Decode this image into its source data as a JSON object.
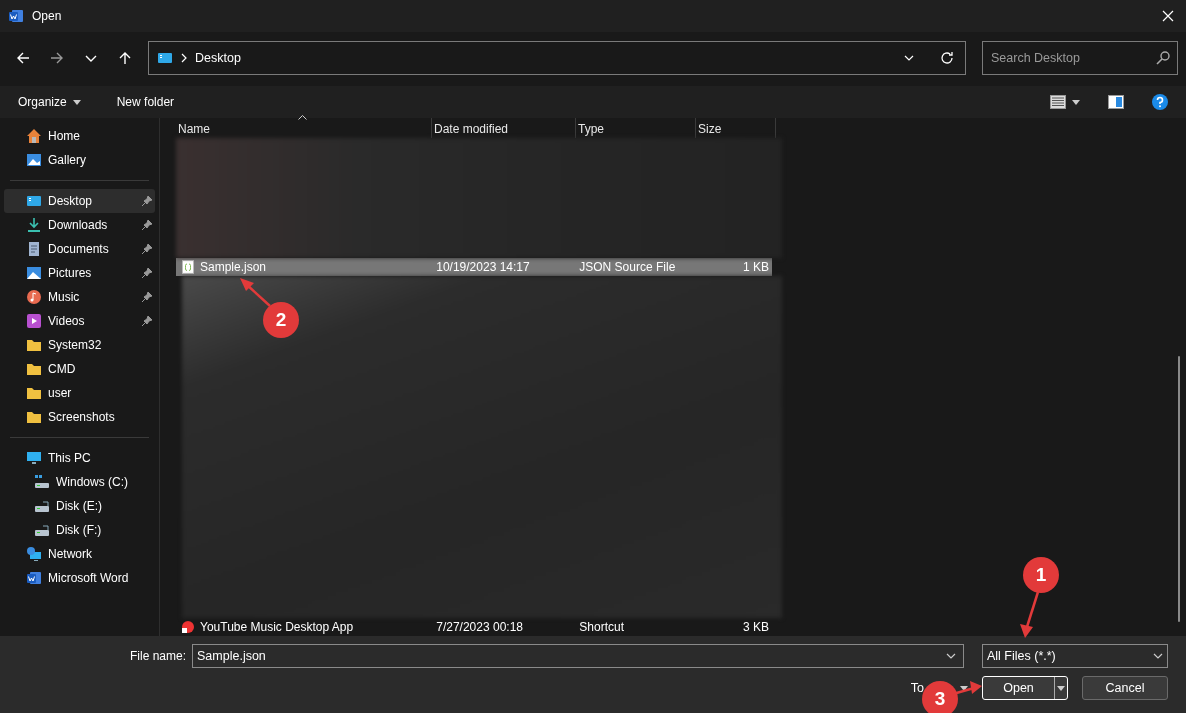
{
  "window": {
    "title": "Open"
  },
  "navigation": {
    "path": [
      "Desktop"
    ],
    "search": {
      "placeholder": "Search Desktop"
    }
  },
  "toolbar": {
    "organize": "Organize",
    "new_folder": "New folder"
  },
  "sidebar": {
    "sections": [
      [
        {
          "label": "Home",
          "kind": "home",
          "pinned": false,
          "selected": false
        },
        {
          "label": "Gallery",
          "kind": "gallery",
          "pinned": false,
          "selected": false
        }
      ],
      [
        {
          "label": "Desktop",
          "kind": "desktop",
          "pinned": true,
          "selected": true
        },
        {
          "label": "Downloads",
          "kind": "downloads",
          "pinned": true,
          "selected": false
        },
        {
          "label": "Documents",
          "kind": "documents",
          "pinned": true,
          "selected": false
        },
        {
          "label": "Pictures",
          "kind": "pictures",
          "pinned": true,
          "selected": false
        },
        {
          "label": "Music",
          "kind": "music",
          "pinned": true,
          "selected": false
        },
        {
          "label": "Videos",
          "kind": "videos",
          "pinned": true,
          "selected": false
        },
        {
          "label": "System32",
          "kind": "folder",
          "pinned": false,
          "selected": false
        },
        {
          "label": "CMD",
          "kind": "folder",
          "pinned": false,
          "selected": false
        },
        {
          "label": "user",
          "kind": "folder",
          "pinned": false,
          "selected": false
        },
        {
          "label": "Screenshots",
          "kind": "folder",
          "pinned": false,
          "selected": false
        }
      ],
      [
        {
          "label": "This PC",
          "kind": "pc",
          "pinned": false,
          "selected": false,
          "children": [
            {
              "label": "Windows (C:)",
              "kind": "system-drive",
              "pinned": false,
              "selected": false
            },
            {
              "label": "Disk (E:)",
              "kind": "drive",
              "pinned": false,
              "selected": false
            },
            {
              "label": "Disk (F:)",
              "kind": "drive",
              "pinned": false,
              "selected": false
            }
          ]
        },
        {
          "label": "Network",
          "kind": "network",
          "pinned": false,
          "selected": false
        },
        {
          "label": "Microsoft Word",
          "kind": "word",
          "pinned": false,
          "selected": false
        }
      ]
    ]
  },
  "file_list": {
    "columns": [
      {
        "label": "Name",
        "sorted": true
      },
      {
        "label": "Date modified",
        "sorted": false
      },
      {
        "label": "Type",
        "sorted": false
      },
      {
        "label": "Size",
        "sorted": false
      }
    ],
    "rows": [
      {
        "kind": "blurred"
      },
      {
        "kind": "file",
        "name": "Sample.json",
        "date": "10/19/2023 14:17",
        "type": "JSON Source File",
        "size": "1 KB",
        "selected": true
      },
      {
        "kind": "blurred"
      },
      {
        "kind": "file",
        "name": "YouTube Music Desktop App",
        "date": "7/27/2023 00:18",
        "type": "Shortcut",
        "size": "3 KB",
        "selected": false
      }
    ]
  },
  "footer": {
    "file_name_label": "File name:",
    "file_name": "Sample.json",
    "file_type": "All Files (*.*)",
    "tools": "To",
    "open": "Open",
    "cancel": "Cancel"
  },
  "annotations": [
    {
      "label": "1"
    },
    {
      "label": "2"
    },
    {
      "label": "3"
    }
  ]
}
